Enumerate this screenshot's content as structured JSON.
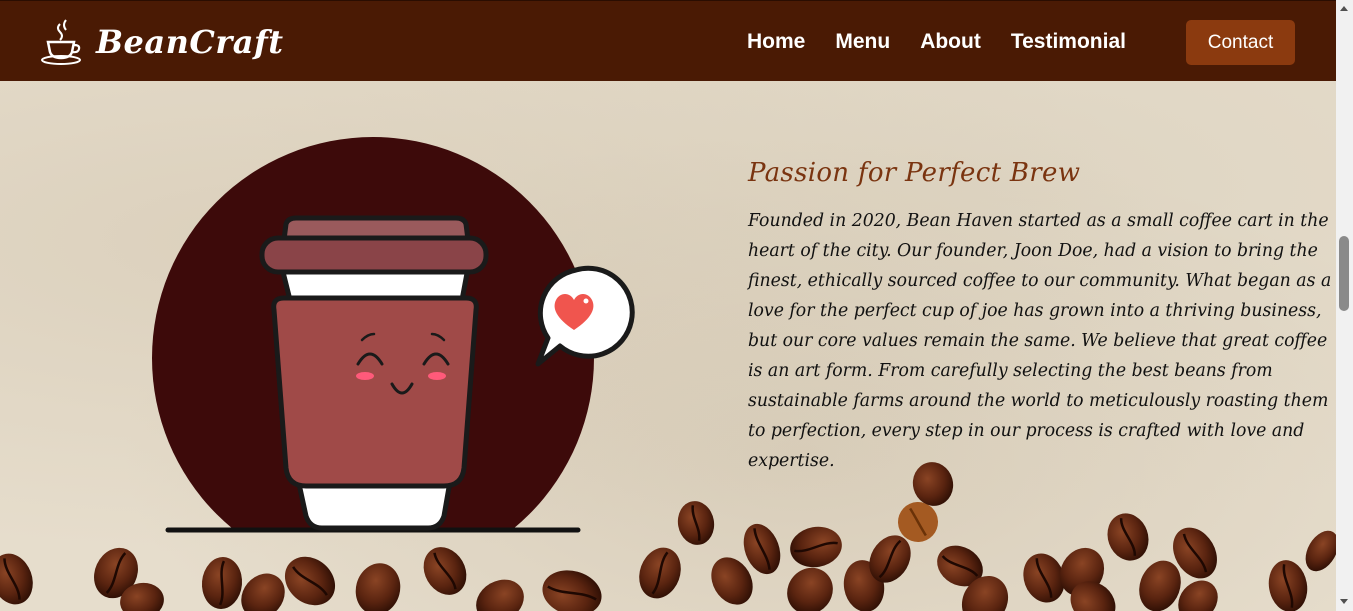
{
  "header": {
    "brand_name": "BeanCraft",
    "brand_icon": "coffee-cup-icon",
    "nav": [
      {
        "label": "Home"
      },
      {
        "label": "Menu"
      },
      {
        "label": "About"
      },
      {
        "label": "Testimonial"
      }
    ],
    "contact_label": "Contact"
  },
  "about": {
    "title": "Passion for Perfect Brew",
    "body": "Founded in 2020, Bean Haven started as a small coffee cart in the heart of the city. Our founder, Joon Doe, had a vision to bring the finest, ethically sourced coffee to our community. What began as a love for the perfect cup of joe has grown into a thriving business, but our core values remain the same. We believe that great coffee is an art form. From carefully selecting the best beans from sustainable farms around the world to meticulously roasting them to perfection, every step in our process is crafted with love and expertise."
  },
  "colors": {
    "header_bg": "#4a1a04",
    "contact_bg": "#8b3a0f",
    "title_color": "#7a3410",
    "circle_bg": "#3d0a0a",
    "cup_body": "#a04a48"
  },
  "illustration": {
    "cup_icon": "smiling-coffee-cup-icon",
    "bubble_icon": "heart-speech-bubble-icon"
  }
}
